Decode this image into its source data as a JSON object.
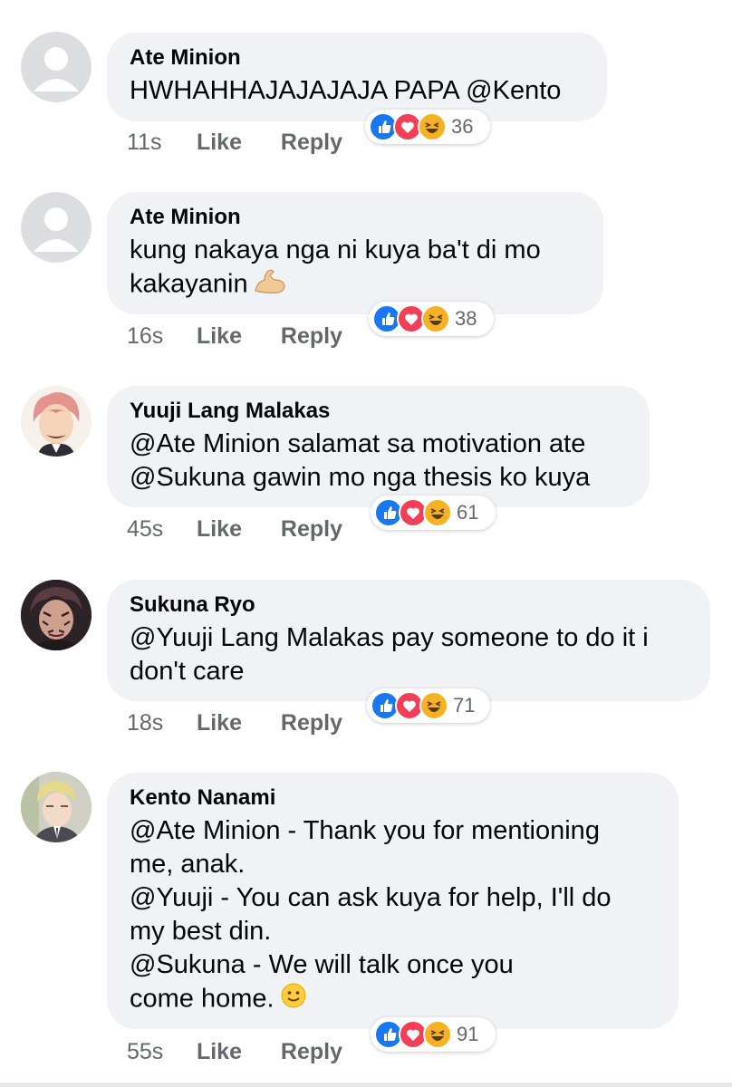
{
  "colors": {
    "bubble": "#f0f2f5",
    "meta_text": "#65676b",
    "like_blue": "#1877f2",
    "love_red": "#f33e58",
    "haha_yellow": "#f7b125"
  },
  "actions": {
    "like": "Like",
    "reply": "Reply"
  },
  "comments": [
    {
      "name": "Ate Minion",
      "avatar": "default-avatar-icon",
      "lines": [
        "HWHAHHAJAJAJAJA PAPA @Kento"
      ],
      "time": "11s",
      "reactions": [
        "like",
        "love",
        "haha"
      ],
      "reaction_count": "36"
    },
    {
      "name": "Ate Minion",
      "avatar": "default-avatar-icon",
      "lines": [
        "kung nakaya nga ni kuya ba't di mo",
        "kakayanin"
      ],
      "emoji": "flexed-biceps-icon",
      "time": "16s",
      "reactions": [
        "like",
        "love",
        "haha"
      ],
      "reaction_count": "38"
    },
    {
      "name": "Yuuji Lang Malakas",
      "avatar": "anime-avatar-pink-hair",
      "lines": [
        "@Ate Minion salamat sa motivation ate",
        "@Sukuna gawin mo nga thesis ko kuya"
      ],
      "time": "45s",
      "reactions": [
        "like",
        "love",
        "haha"
      ],
      "reaction_count": "61"
    },
    {
      "name": "Sukuna Ryo",
      "avatar": "anime-avatar-dark",
      "lines": [
        "@Yuuji Lang Malakas pay someone to do it i",
        "don't care"
      ],
      "time": "18s",
      "reactions": [
        "like",
        "love",
        "haha"
      ],
      "reaction_count": "71"
    },
    {
      "name": "Kento Nanami",
      "avatar": "anime-avatar-blond",
      "lines": [
        "@Ate Minion - Thank you for mentioning",
        "me, anak.",
        "@Yuuji - You can ask kuya for help, I'll do",
        "my best din.",
        "@Sukuna - We will talk once you",
        "come home."
      ],
      "emoji": "slightly-smiling-face-icon",
      "time": "55s",
      "reactions": [
        "like",
        "love",
        "haha"
      ],
      "reaction_count": "91"
    }
  ]
}
